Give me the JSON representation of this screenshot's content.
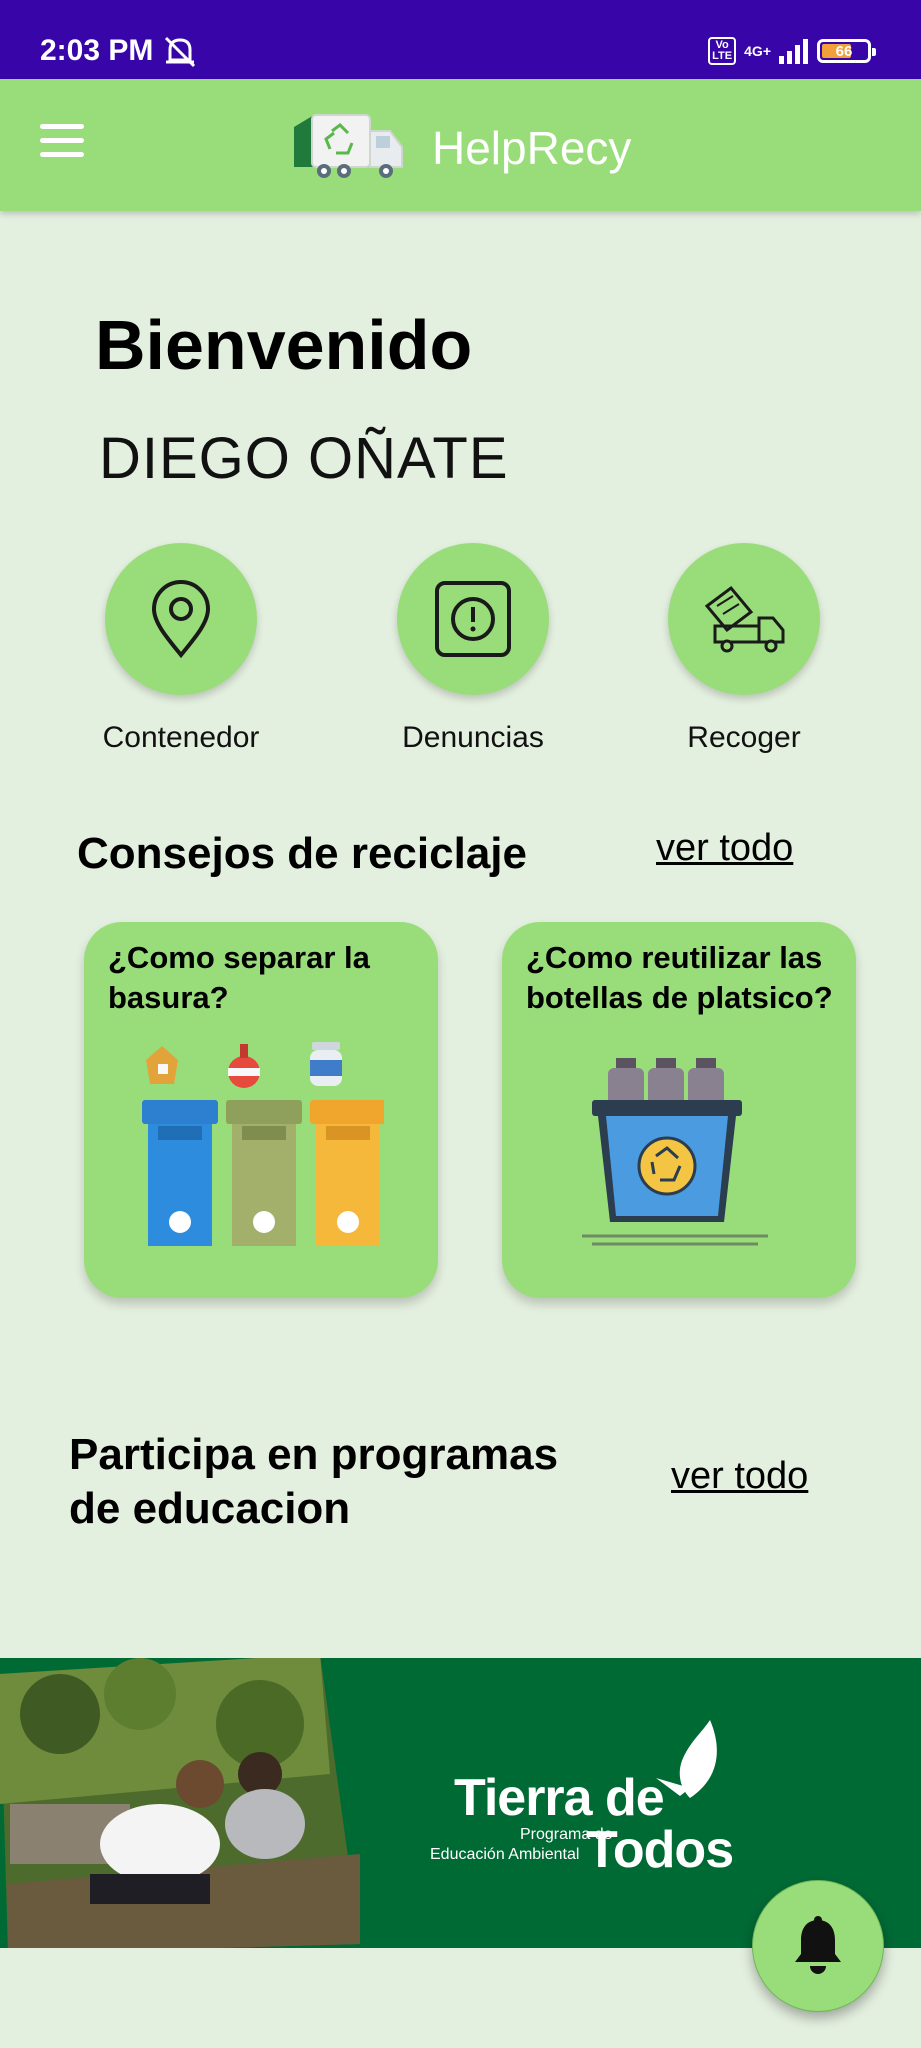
{
  "status_bar": {
    "time": "2:03 PM",
    "network_badge": "Vo LTE",
    "network_type": "4G+",
    "battery_level": "66"
  },
  "app_bar": {
    "title": "HelpRecy",
    "menu_icon": "hamburger-menu-icon",
    "logo_icon": "recycling-truck-logo"
  },
  "welcome": {
    "greeting": "Bienvenido",
    "user_name": "DIEGO OÑATE"
  },
  "quick_actions": [
    {
      "label": "Contenedor",
      "icon": "location-pin-icon"
    },
    {
      "label": "Denuncias",
      "icon": "alert-report-icon"
    },
    {
      "label": "Recoger",
      "icon": "pickup-truck-icon"
    }
  ],
  "tips_section": {
    "title": "Consejos de reciclaje",
    "see_all": "ver todo",
    "cards": [
      {
        "title": "¿Como separar la basura?",
        "image": "sorting-bins-illustration"
      },
      {
        "title": "¿Como reutilizar las botellas de platsico?",
        "image": "bottle-recycling-bin-illustration"
      }
    ]
  },
  "education_section": {
    "title": "Participa en programas de educacion",
    "see_all": "ver todo",
    "banner": {
      "brand_line1": "Tierra de",
      "brand_line2": "Todos",
      "subtitle_line1": "Programa de",
      "subtitle_line2": "Educación Ambiental"
    }
  },
  "fab": {
    "icon": "bell-icon"
  },
  "colors": {
    "status_bar": "#3806a8",
    "primary_green": "#99dd7b",
    "background": "#e3efdf",
    "banner_green": "#006a35"
  }
}
